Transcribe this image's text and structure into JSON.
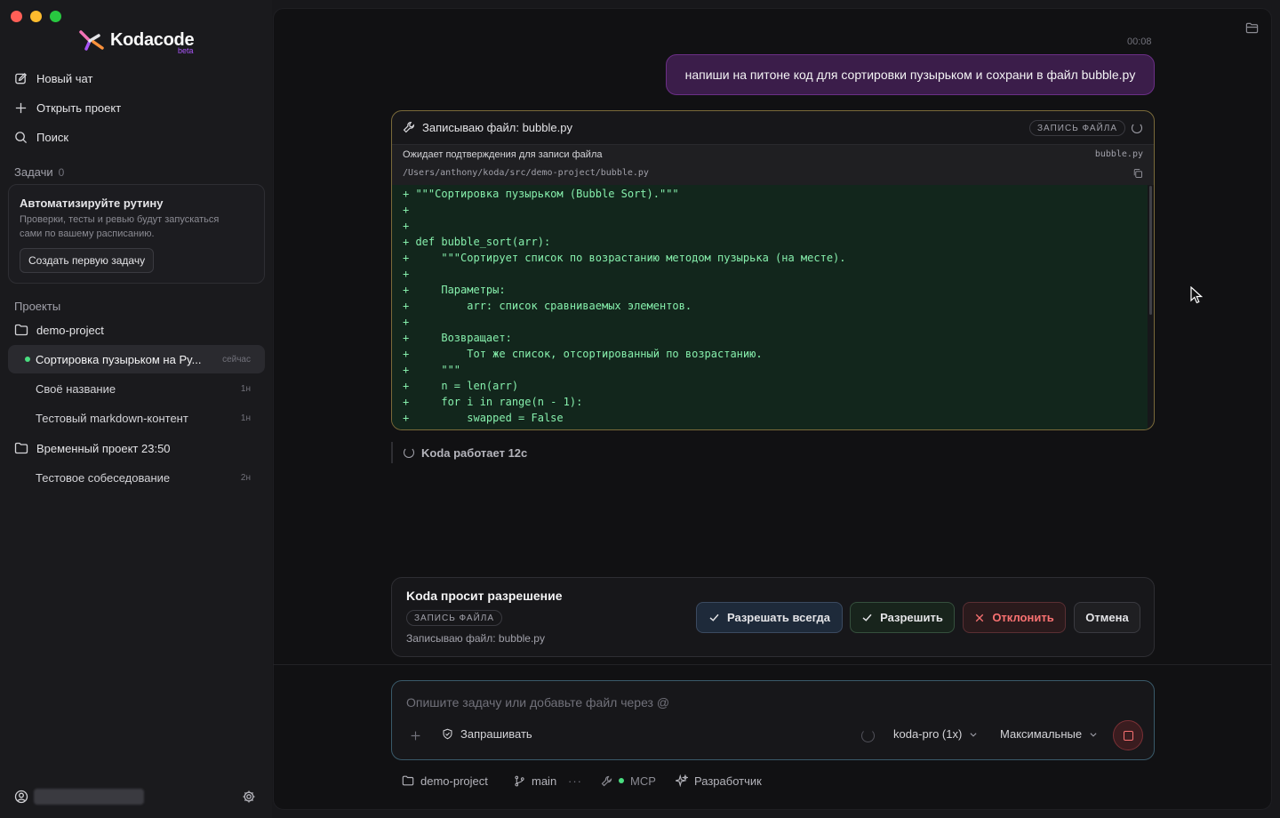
{
  "app": {
    "name": "Kodacode",
    "badge": "beta"
  },
  "sidebar": {
    "nav": {
      "new_chat": "Новый чат",
      "open_project": "Открыть проект",
      "search": "Поиск"
    },
    "tasks": {
      "label": "Задачи",
      "count": "0",
      "card_title": "Автоматизируйте рутину",
      "card_desc": "Проверки, тесты и ревью будут запускаться сами по вашему расписанию.",
      "card_button": "Создать первую задачу"
    },
    "projects_label": "Проекты",
    "projects": [
      {
        "name": "demo-project",
        "chats": [
          {
            "title": "Сортировка пузырьком на Py...",
            "time": "сейчас",
            "active": true
          },
          {
            "title": "Своё название",
            "time": "1н"
          },
          {
            "title": "Тестовый markdown-контент",
            "time": "1н"
          }
        ]
      },
      {
        "name": "Временный проект 23:50",
        "chats": [
          {
            "title": "Тестовое собеседование",
            "time": "2н"
          }
        ]
      }
    ]
  },
  "conversation": {
    "timestamp": "00:08",
    "user_message": "напиши на питоне код для сортировки пузырьком и сохрани в файл bubble.py",
    "tool": {
      "title": "Записываю файл: bubble.py",
      "badge": "ЗАПИСЬ ФАЙЛА",
      "status": "Ожидает подтверждения для записи файла",
      "filename": "bubble.py",
      "path": "/Users/anthony/koda/src/demo-project/bubble.py",
      "code_lines": [
        "+ \"\"\"Сортировка пузырьком (Bubble Sort).\"\"\"",
        "+",
        "+",
        "+ def bubble_sort(arr):",
        "+     \"\"\"Сортирует список по возрастанию методом пузырька (на месте).",
        "+",
        "+     Параметры:",
        "+         arr: список сравниваемых элементов.",
        "+",
        "+     Возвращает:",
        "+         Тот же список, отсортированный по возрастанию.",
        "+     \"\"\"",
        "+     n = len(arr)",
        "+     for i in range(n - 1):",
        "+         swapped = False"
      ]
    },
    "working_status": "Koda работает 12с"
  },
  "permission": {
    "title": "Koda просит разрешение",
    "badge": "ЗАПИСЬ ФАЙЛА",
    "description": "Записываю файл: bubble.py",
    "buttons": {
      "always": "Разрешать всегда",
      "allow": "Разрешить",
      "deny": "Отклонить",
      "cancel": "Отмена"
    }
  },
  "composer": {
    "placeholder": "Опишите задачу или добавьте файл через @",
    "mode": "Запрашивать",
    "model": "koda-pro (1x)",
    "effort": "Максимальные"
  },
  "footer": {
    "project": "demo-project",
    "branch": "main",
    "mcp": "MCP",
    "developer": "Разработчик"
  },
  "colors": {
    "accent_purple": "#a855f7",
    "user_bubble": "#3b1d4a",
    "code_added": "#86efac",
    "deny_red": "#f87171",
    "online_green": "#4ade80"
  }
}
